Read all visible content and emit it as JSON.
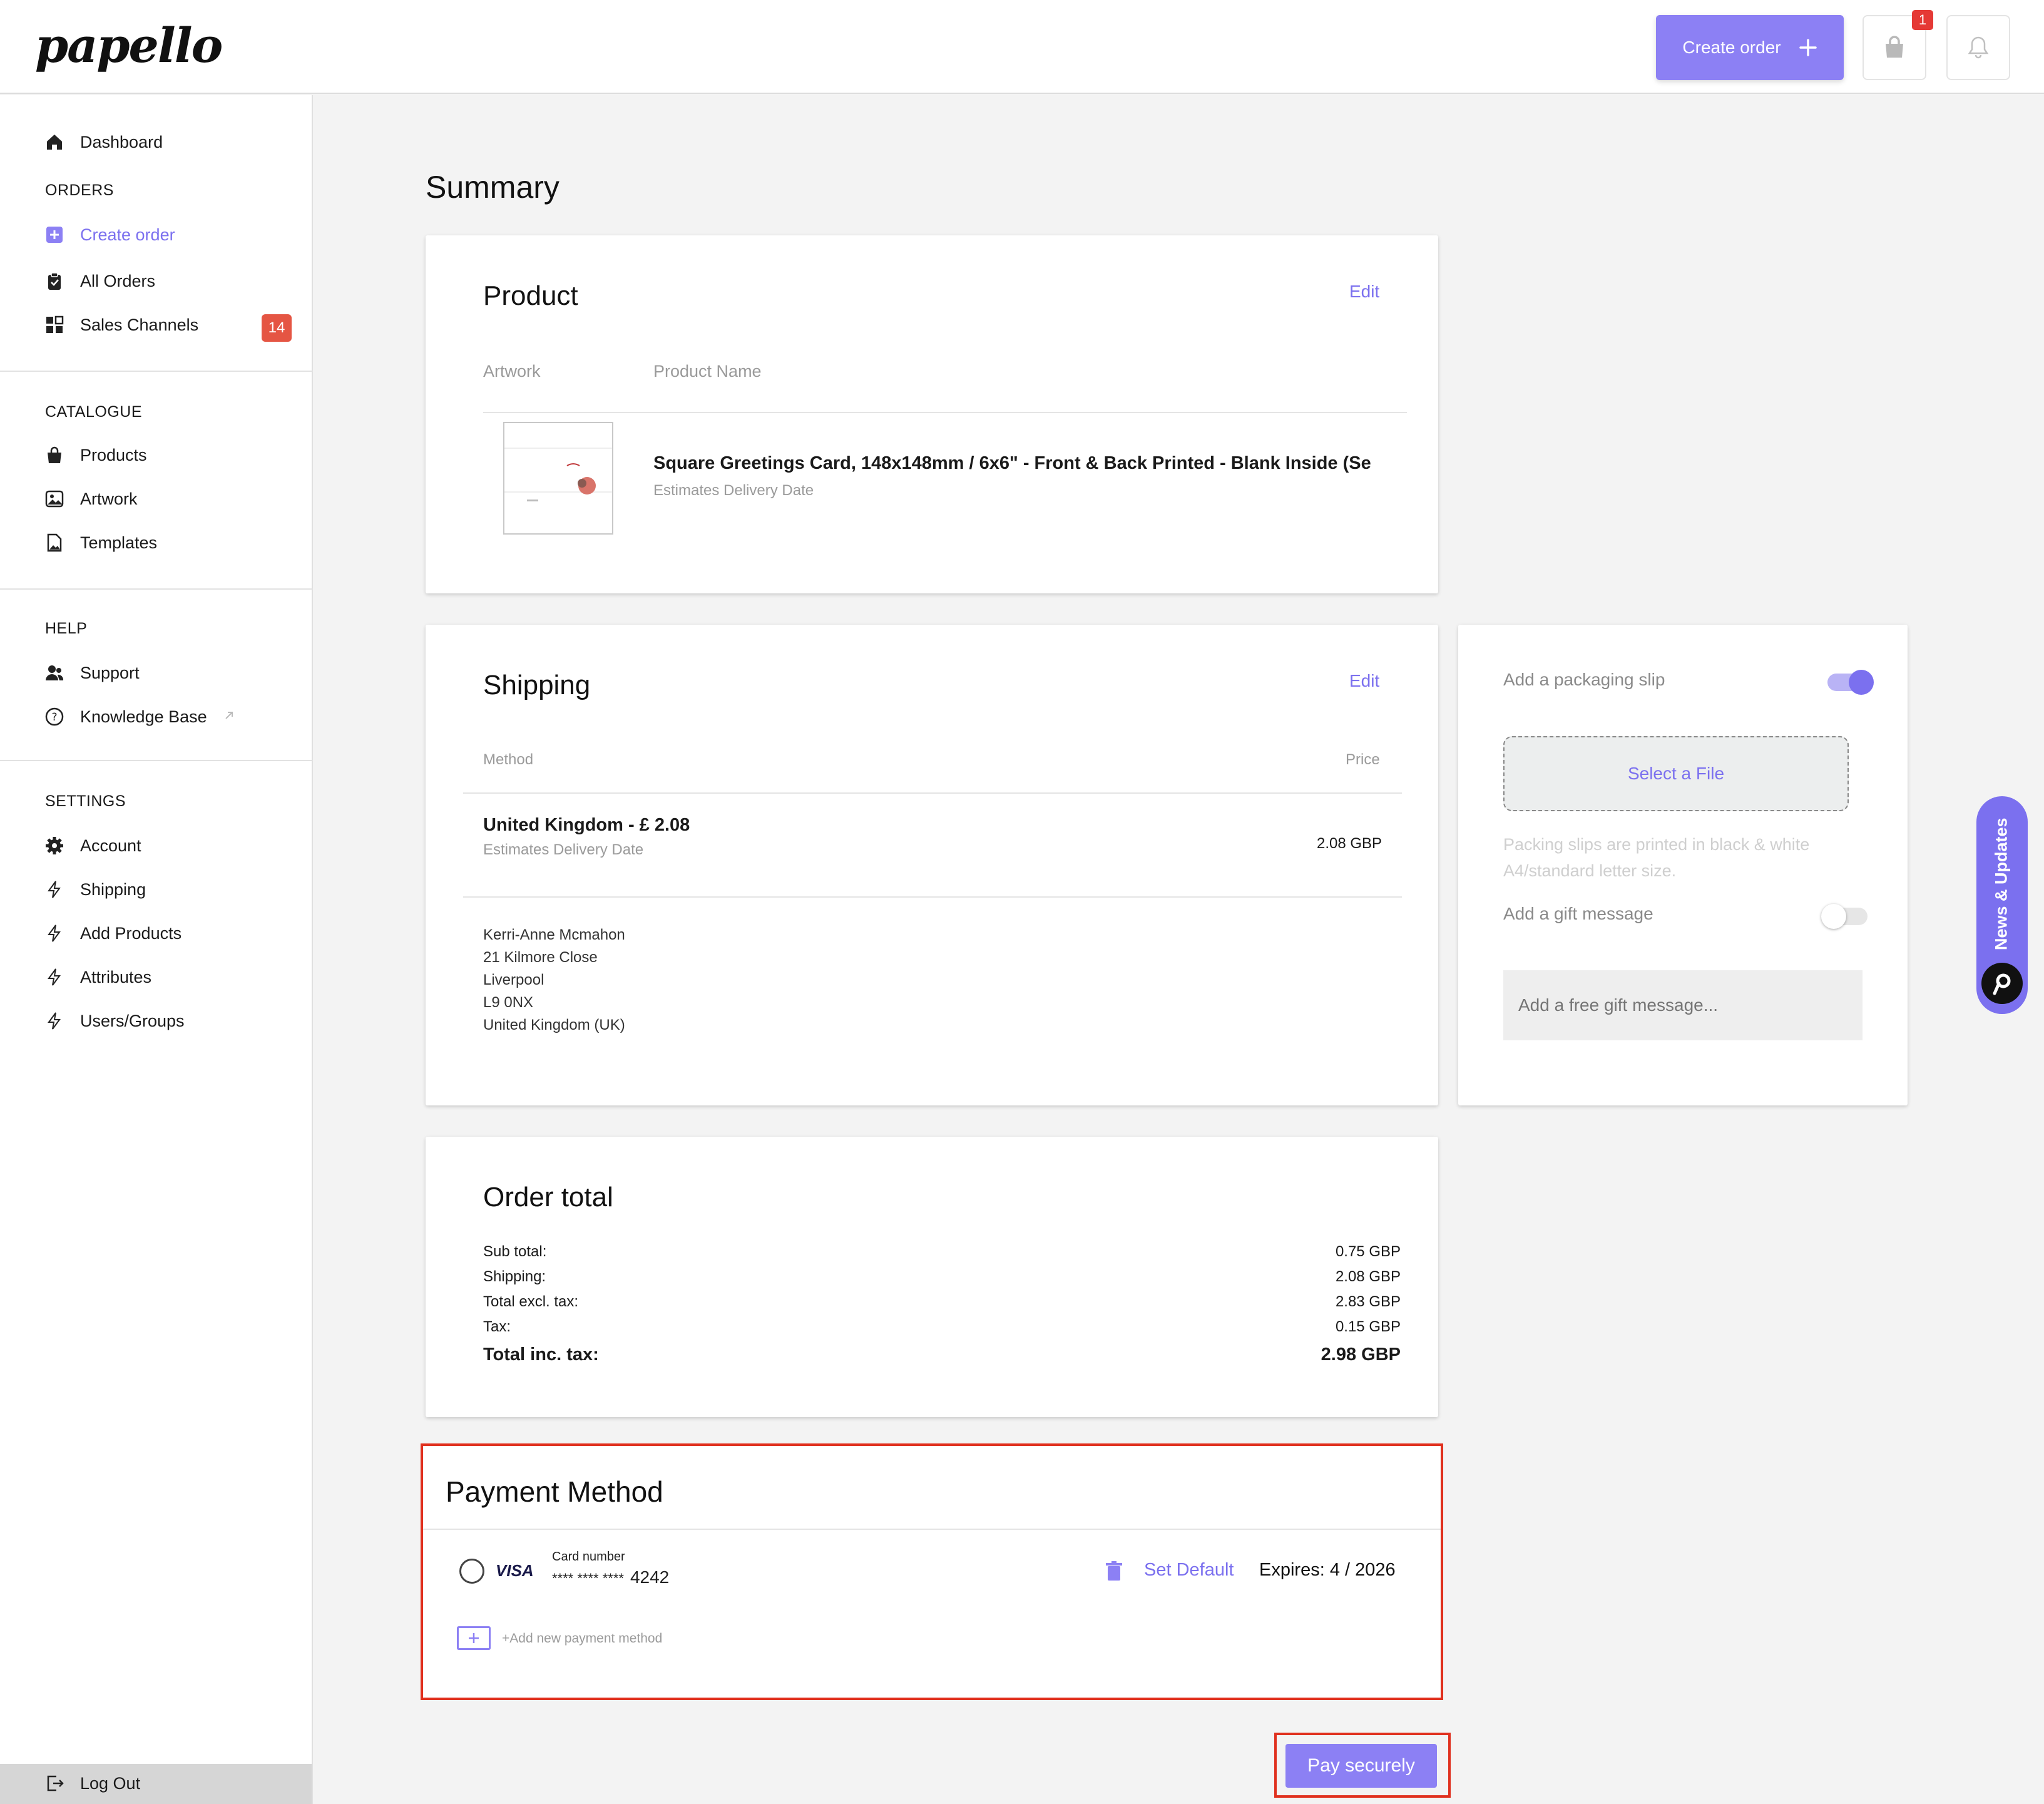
{
  "header": {
    "logo_text": "papello",
    "create_order_label": "Create order",
    "cart_count": "1"
  },
  "sidebar": {
    "dashboard": "Dashboard",
    "orders_heading": "ORDERS",
    "create_order": "Create order",
    "all_orders": "All Orders",
    "sales_channels": "Sales Channels",
    "sales_channels_badge": "14",
    "catalogue_heading": "CATALOGUE",
    "products": "Products",
    "artwork": "Artwork",
    "templates": "Templates",
    "help_heading": "HELP",
    "support": "Support",
    "knowledge_base": "Knowledge Base",
    "settings_heading": "SETTINGS",
    "account": "Account",
    "shipping": "Shipping",
    "add_products": "Add Products",
    "attributes": "Attributes",
    "users_groups": "Users/Groups",
    "log_out": "Log Out"
  },
  "main": {
    "title": "Summary",
    "product": {
      "title": "Product",
      "edit": "Edit",
      "col_artwork": "Artwork",
      "col_product_name": "Product Name",
      "name": "Square Greetings Card, 148x148mm / 6x6\" - Front & Back Printed - Blank Inside (Se",
      "delivery": "Estimates Delivery Date"
    },
    "shipping": {
      "title": "Shipping",
      "edit": "Edit",
      "col_method": "Method",
      "col_price": "Price",
      "method": "United Kingdom - £ 2.08",
      "delivery": "Estimates Delivery Date",
      "price": "2.08 GBP",
      "address": [
        "Kerri-Anne Mcmahon",
        "21 Kilmore Close",
        "Liverpool",
        "L9 0NX",
        "United Kingdom (UK)"
      ]
    },
    "extras": {
      "packaging_slip_label": "Add a packaging slip",
      "select_file": "Select a File",
      "slip_note_line1": "Packing slips are printed in black & white",
      "slip_note_line2": "A4/standard letter size.",
      "gift_message_label": "Add a gift message",
      "gift_message_placeholder": "Add a free gift message..."
    },
    "order_total": {
      "title": "Order total",
      "rows": [
        {
          "label": "Sub total:",
          "value": "0.75 GBP"
        },
        {
          "label": "Shipping:",
          "value": "2.08 GBP"
        },
        {
          "label": "Total excl. tax:",
          "value": "2.83 GBP"
        },
        {
          "label": "Tax:",
          "value": "0.15 GBP"
        }
      ],
      "total_label": "Total inc. tax:",
      "total_value": "2.98 GBP"
    },
    "payment": {
      "title": "Payment Method",
      "card_brand": "VISA",
      "card_number_label": "Card number",
      "card_mask": "**** **** ****",
      "card_last4": "4242",
      "set_default": "Set Default",
      "expires": "Expires: 4 / 2026",
      "add_new": "+Add new payment method"
    },
    "pay_button": "Pay securely"
  },
  "news_tab": {
    "label": "News & Updates"
  },
  "colors": {
    "accent": "#8c80f4",
    "badge": "#e55543",
    "highlight": "#e0301e"
  }
}
